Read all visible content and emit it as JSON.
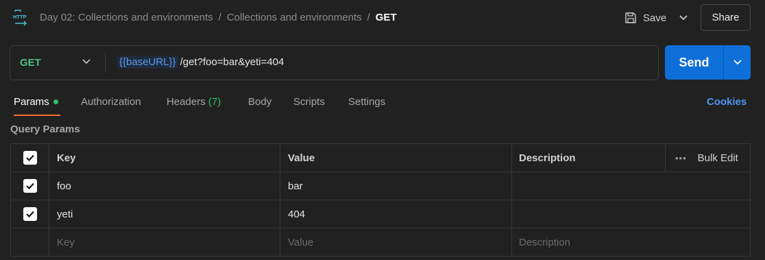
{
  "header": {
    "icon": "http-icon",
    "breadcrumb": [
      "Day 02: Collections and environments",
      "Collections and environments"
    ],
    "separator": "/",
    "current": "GET",
    "save_label": "Save",
    "share_label": "Share"
  },
  "request": {
    "method": "GET",
    "url_variable": "{{baseURL}}",
    "url_path": "/get?foo=bar&yeti=404",
    "send_label": "Send"
  },
  "tabs": {
    "params": "Params",
    "authorization": "Authorization",
    "headers": "Headers",
    "headers_count": "(7)",
    "body": "Body",
    "scripts": "Scripts",
    "settings": "Settings",
    "cookies": "Cookies"
  },
  "query_params": {
    "title": "Query Params",
    "columns": {
      "key": "Key",
      "value": "Value",
      "description": "Description",
      "bulk_edit": "Bulk Edit"
    },
    "rows": [
      {
        "key": "foo",
        "value": "bar",
        "description": "",
        "checked": true
      },
      {
        "key": "yeti",
        "value": "404",
        "description": "",
        "checked": true
      }
    ],
    "placeholders": {
      "key": "Key",
      "value": "Value",
      "description": "Description"
    }
  },
  "colors": {
    "method": "#4cbf82",
    "send": "#0f6fd9",
    "tab_underline": "#ff6c37",
    "variable": "#5b9cf2",
    "cookies": "#4f97f0"
  }
}
